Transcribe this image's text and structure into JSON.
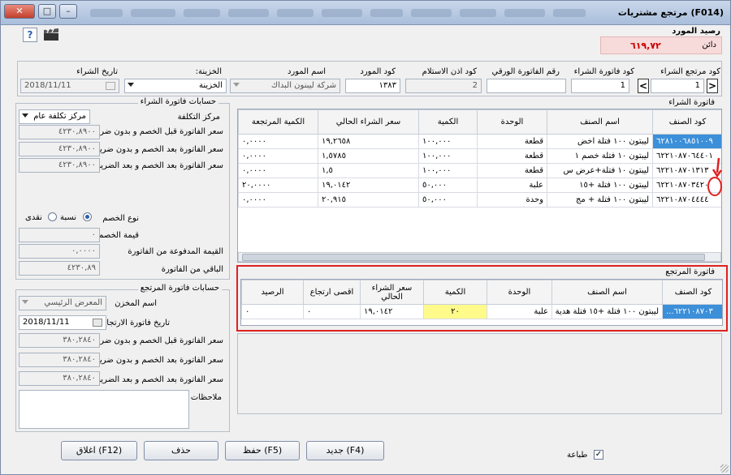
{
  "window": {
    "title": "(F014)  مرتجع مشتريات"
  },
  "supplier_balance": {
    "label": "رصيد المورد",
    "amount": "٦١٩,٧٢",
    "status": "دائن"
  },
  "header": {
    "return_code_label": "كود مرتجع الشراء",
    "return_code": "1",
    "invoice_code_label": "كود فاتورة الشراء",
    "invoice_code": "1",
    "paper_invoice_label": "رقم الفاتورة الورقي",
    "paper_invoice": "",
    "receipt_code_label": "كود اذن الاستلام",
    "receipt_code": "2",
    "supplier_code_label": "كود المورد",
    "supplier_code": "١٣٨٣",
    "supplier_name_label": "اسم المورد",
    "supplier_name": "شركة ليبنون البداك",
    "treasury_label": "الخزينة:",
    "treasury": "الخزينة",
    "purchase_date_label": "تاريخ الشراء",
    "purchase_date": "2018/11/11"
  },
  "purchase_invoice": {
    "title": "فاتورة الشراء",
    "columns": [
      "كود الصنف",
      "اسم الصنف",
      "الوحدة",
      "الكمية",
      "سعر الشراء الحالي",
      "الكمية المرتجعة"
    ],
    "rows": [
      [
        "٦٢٨١٠٠٦٨٥١٠٠٩",
        "ليبتون ١٠٠ فتلة اخض",
        "قطعة",
        "١٠٠,٠٠٠",
        "١٩,٢٦٥٨",
        "٠,٠٠٠٠"
      ],
      [
        "٦٢٢١٠٨٧٠٦٤٤٠١",
        "ليبتون ١٠ فتلة خصم ١",
        "قطعة",
        "١٠٠,٠٠٠",
        "١,٥٧٨٥",
        "٠,٠٠٠٠"
      ],
      [
        "٦٢٢١٠٨٧٠١٣١٣",
        "ليبتون ١٠ فتلة+عرض س",
        "قطعة",
        "١٠٠,٠٠٠",
        "١,٥",
        "٠,٠٠٠٠"
      ],
      [
        "٦٢٢١٠٨٧٠٣٤٢٠",
        "ليبتون ١٠٠ فتلة +١٥",
        "علبة",
        "٥٠,٠٠٠",
        "١٩,٠١٤٢",
        "٢٠,٠٠٠٠"
      ],
      [
        "٦٢٢١٠٨٧٠٤٤٤٤",
        "ليبتون ١٠٠ فتلة + مج",
        "وحدة",
        "٥٠,٠٠٠",
        "٢٠,٩١٥",
        "٠,٠٠٠٠"
      ]
    ]
  },
  "return_invoice": {
    "title": "فاتورة المرتجع",
    "columns": [
      "كود الصنف",
      "اسم الصنف",
      "الوحدة",
      "الكمية",
      "سعر الشراء الحالي",
      "اقصى ارتجاع",
      "الرصيد"
    ],
    "rows": [
      [
        "...٦٢٢١٠٨٧٠٣",
        "ليبتون ١٠٠ فتلة +١٥ فتلة هدية",
        "علبة",
        "٢٠",
        "١٩,٠١٤٢",
        "٠",
        "٠"
      ]
    ]
  },
  "invoice_accounts": {
    "title": "حسابات فاتورة الشراء",
    "cost_center_label": "مركز التكلفة",
    "cost_center": "مركز تكلفة عام",
    "price_before_label": "سعر الفاتورة قبل الخصم و بدون ضريبة",
    "price_before": "٤٢٣٠,٨٩٠٠",
    "price_after_no_tax_label": "سعر الفاتورة بعد الخصم و بدون ضريبة",
    "price_after_no_tax": "٤٢٣٠,٨٩٠٠",
    "price_after_tax_label": "سعر الفاتورة بعد الخصم و بعد الضريبة",
    "price_after_tax": "٤٢٣٠,٨٩٠٠",
    "discount_type_label": "نوع الخصم",
    "discount_percent": "نسبة",
    "discount_cash": "نقدى",
    "discount_value_label": "قيمة الخصم",
    "discount_value": "٠",
    "paid_label": "القيمة المدفوعة من الفاتورة",
    "paid": "٠,٠٠٠٠",
    "remaining_label": "الباقي من الفاتورة",
    "remaining": "٤٢٣٠,٨٩"
  },
  "return_accounts": {
    "title": "حسابات فاتورة المرتجع",
    "store_label": "اسم المخزن",
    "store": "المعرض الرئيسي",
    "return_date_label": "تاريخ فاتورة الارتجاع",
    "return_date": "2018/11/11",
    "price_before_label": "سعر الفاتورة قبل الخصم و بدون ضريبة",
    "price_before": "٣٨٠,٢٨٤٠",
    "price_after_no_tax_label": "سعر الفاتورة بعد الخصم و بدون ضريبة",
    "price_after_no_tax": "٣٨٠,٢٨٤٠",
    "price_after_tax_label": "سعر الفاتورة بعد الخصم و بعد الضريبة",
    "price_after_tax": "٣٨٠,٢٨٤٠",
    "notes_label": "ملاحظات",
    "notes": ""
  },
  "footer": {
    "print_label": "طباعة",
    "print_checked": "✓",
    "new_label": "جديد (F4)",
    "save_label": "حفظ (F5)",
    "delete_label": "حذف",
    "close_label": "اغلاق (F12)"
  },
  "colors": {
    "accent": "#3c8fd9",
    "highlight": "#fffb8a",
    "annotation": "#e02020"
  }
}
